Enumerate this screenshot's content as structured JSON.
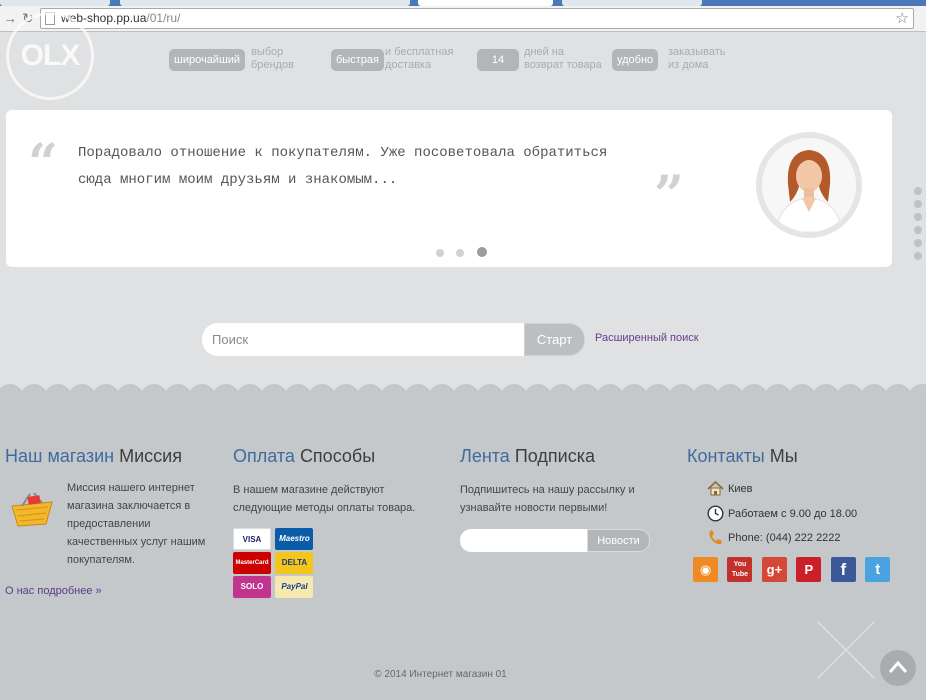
{
  "browser": {
    "url_host": "web-shop.pp.ua",
    "url_path": "/01/ru/"
  },
  "watermark": "OLX",
  "benefits": [
    {
      "badge": "широчайший",
      "line1": "выбор",
      "line2": "брендов"
    },
    {
      "badge": "быстрая",
      "line1": "и бесплатная",
      "line2": "доставка"
    },
    {
      "badge": "14",
      "line1": "дней на",
      "line2": "возврат товара"
    },
    {
      "badge": "удобно",
      "line1": "заказывать",
      "line2": "из дома"
    }
  ],
  "testimonial": {
    "text": "Порадовало отношение к покупателям. Уже посоветовала обратиться сюда многим моим друзьям и знакомым...",
    "active_slide": 3,
    "slide_count": 3
  },
  "search": {
    "placeholder": "Поиск",
    "button": "Старт",
    "advanced_link": "Расширенный поиск"
  },
  "footer": {
    "shop": {
      "title_accent": "Наш магазин",
      "title_rest": "Миссия",
      "text": "Миссия нашего интернет магазина заключается в предоставлении качественных услуг нашим покупателям.",
      "more_link": "О нас подробнее »"
    },
    "payment": {
      "title_accent": "Оплата",
      "title_rest": "Способы",
      "text": "В нашем магазине действуют следующие методы оплаты товара.",
      "cards": [
        "VISA",
        "Maestro",
        "MasterCard",
        "DELTA",
        "SOLO",
        "PayPal"
      ]
    },
    "newsletter": {
      "title_accent": "Лента",
      "title_rest": "Подписка",
      "text": "Подпишитесь на нашу рассылку и узнавайте новости первыми!",
      "button": "Новости"
    },
    "contacts": {
      "title_accent": "Контакты",
      "title_rest": "Мы",
      "city": "Киев",
      "hours": "Работаем с 9.00 до 18.00",
      "phone": "Phone: (044) 222 2222",
      "socials": [
        {
          "icon": "rss-icon",
          "glyph": "◉",
          "color": "#f08a24"
        },
        {
          "icon": "youtube-icon",
          "glyph": "You Tube",
          "color": "#c4302b"
        },
        {
          "icon": "google-plus-icon",
          "glyph": "g+",
          "color": "#d34836"
        },
        {
          "icon": "pinterest-icon",
          "glyph": "P",
          "color": "#cb2027"
        },
        {
          "icon": "facebook-icon",
          "glyph": "f",
          "color": "#3b5998"
        },
        {
          "icon": "twitter-icon",
          "glyph": "t",
          "color": "#4aa3df"
        }
      ]
    },
    "copyright": "© 2014 Интернет магазин 01"
  }
}
